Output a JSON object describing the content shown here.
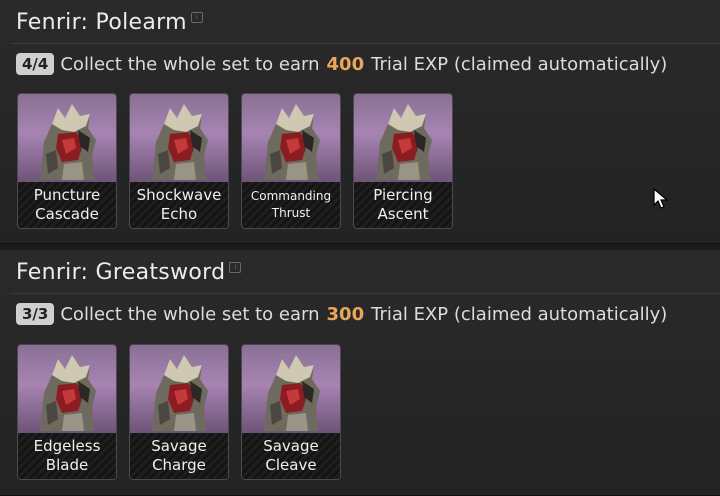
{
  "sets": [
    {
      "title": "Fenrir: Polearm",
      "info_icon": "info-icon",
      "progress": "4/4",
      "requirement_prefix": "Collect the whole set to earn",
      "exp_amount": "400",
      "requirement_suffix": "Trial EXP (claimed automatically)",
      "items": [
        {
          "label_line1": "Puncture",
          "label_line2": "Cascade"
        },
        {
          "label_line1": "Shockwave",
          "label_line2": "Echo"
        },
        {
          "label_line1": "Commanding",
          "label_line2": "Thrust"
        },
        {
          "label_line1": "Piercing",
          "label_line2": "Ascent"
        }
      ]
    },
    {
      "title": "Fenrir: Greatsword",
      "info_icon": "info-icon",
      "progress": "3/3",
      "requirement_prefix": "Collect the whole set to earn",
      "exp_amount": "300",
      "requirement_suffix": "Trial EXP (claimed automatically)",
      "items": [
        {
          "label_line1": "Edgeless",
          "label_line2": "Blade"
        },
        {
          "label_line1": "Savage",
          "label_line2": "Charge"
        },
        {
          "label_line1": "Savage",
          "label_line2": "Cleave"
        }
      ]
    }
  ],
  "colors": {
    "accent_exp": "#e8a75a",
    "badge_bg": "#cfcfcf",
    "card_art": "#a784b3"
  },
  "icons": {
    "card_art": "fenrir-wolf-helm-icon",
    "cursor": "mouse-pointer-icon"
  }
}
